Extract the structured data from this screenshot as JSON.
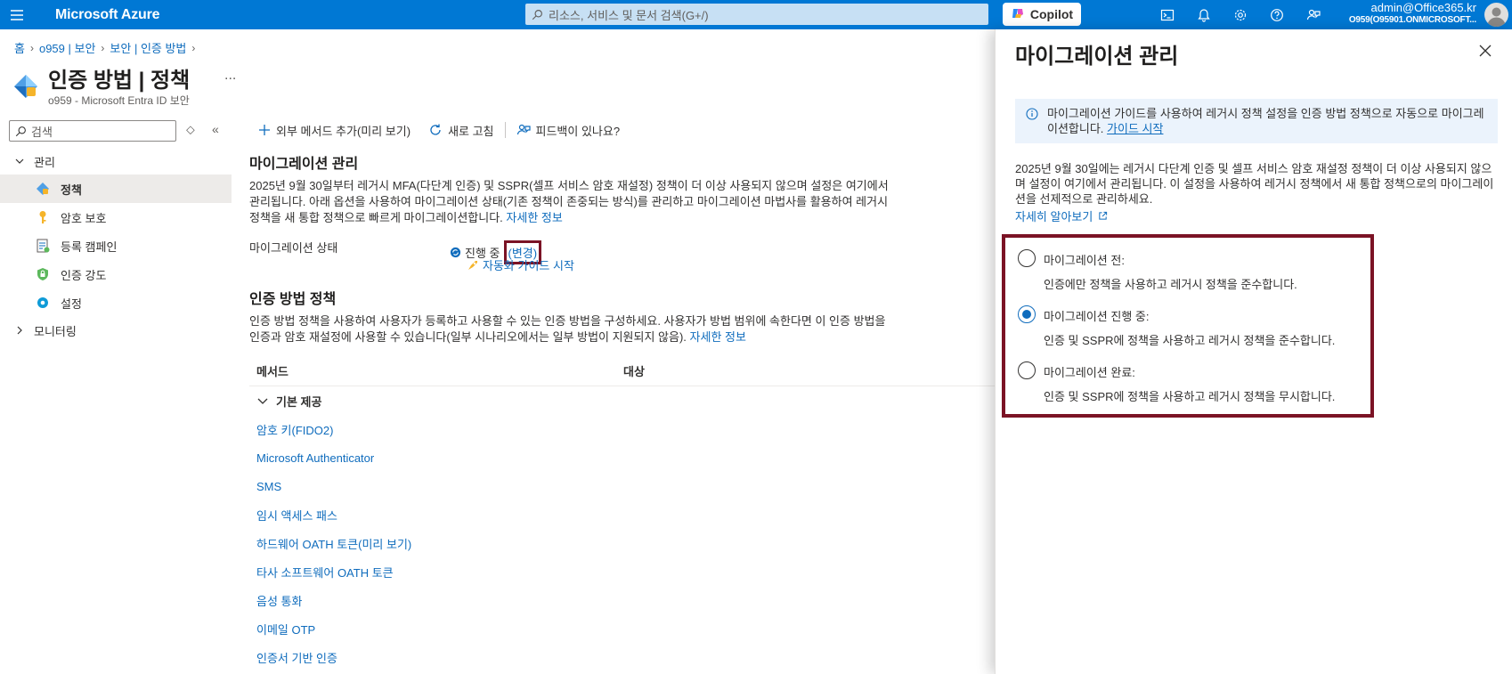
{
  "topbar": {
    "brand": "Microsoft Azure",
    "search_placeholder": "리소스, 서비스 및 문서 검색(G+/)",
    "copilot_label": "Copilot",
    "account_user": "admin@Office365.kr",
    "account_tenant": "O959(O95901.ONMICROSOFT...",
    "icons": [
      "cloud-shell-icon",
      "bell-icon",
      "gear-icon",
      "help-icon",
      "feedback-icon"
    ]
  },
  "breadcrumb": [
    "홈",
    "o959 | 보안",
    "보안 | 인증 방법"
  ],
  "page": {
    "title": "인증 방법 | 정책",
    "subtitle": "o959 - Microsoft Entra ID 보안",
    "more": "..."
  },
  "nav": {
    "search_placeholder": "검색",
    "groups": [
      {
        "label": "관리",
        "expanded": true
      },
      {
        "label": "모니터링",
        "expanded": false
      }
    ],
    "items": [
      {
        "label": "정책",
        "icon": "policy-icon",
        "active": true
      },
      {
        "label": "암호 보호",
        "icon": "key-icon",
        "active": false
      },
      {
        "label": "등록 캠페인",
        "icon": "campaign-icon",
        "active": false
      },
      {
        "label": "인증 강도",
        "icon": "lock-shield-icon",
        "active": false
      },
      {
        "label": "설정",
        "icon": "gear-icon",
        "active": false
      }
    ]
  },
  "toolbar": {
    "add_external": "외부 메서드 추가(미리 보기)",
    "refresh": "새로 고침",
    "feedback": "피드백이 있나요?"
  },
  "migration": {
    "heading": "마이그레이션 관리",
    "description": "2025년 9월 30일부터 레거시 MFA(다단계 인증) 및 SSPR(셀프 서비스 암호 재설정) 정책이 더 이상 사용되지 않으며 설정은 여기에서 관리됩니다. 아래 옵션을 사용하여 마이그레이션 상태(기존 정책이 존중되는 방식)를 관리하고 마이그레이션 마법사를 활용하여 레거시 정책을 새 통합 정책으로 빠르게 마이그레이션합니다.",
    "learn_more": "자세한 정보",
    "status_label": "마이그레이션 상태",
    "status_value": "진행 중",
    "change_link": "(변경)",
    "guide_link": "자동화 가이드 시작"
  },
  "policy": {
    "heading": "인증 방법 정책",
    "description": "인증 방법 정책을 사용하여 사용자가 등록하고 사용할 수 있는 인증 방법을 구성하세요. 사용자가 방법 범위에 속한다면 이 인증 방법을 인증과 암호 재설정에 사용할 수 있습니다(일부 시나리오에서는 일부 방법이 지원되지 않음).",
    "learn_more": "자세한 정보"
  },
  "table": {
    "col_method": "메서드",
    "col_target": "대상",
    "group": "기본 제공",
    "methods": [
      "암호 키(FIDO2)",
      "Microsoft Authenticator",
      "SMS",
      "임시 액세스 패스",
      "하드웨어 OATH 토큰(미리 보기)",
      "타사 소프트웨어 OATH 토큰",
      "음성 통화",
      "이메일 OTP",
      "인증서 기반 인증"
    ]
  },
  "panel": {
    "title": "마이그레이션 관리",
    "info_text": "마이그레이션 가이드를 사용하여 레거시 정책 설정을 인증 방법 정책으로 자동으로 마이그레이션합니다.",
    "info_link": "가이드 시작",
    "description": "2025년 9월 30일에는 레거시 다단계 인증 및 셀프 서비스 암호 재설정 정책이 더 이상 사용되지 않으며 설정이 여기에서 관리됩니다. 이 설정을 사용하여 레거시 정책에서 새 통합 정책으로의 마이그레이션을 선제적으로 관리하세요.",
    "learn_more": "자세히 알아보기",
    "options": [
      {
        "label": "마이그레이션 전:",
        "desc": "인증에만 정책을 사용하고 레거시 정책을 준수합니다.",
        "checked": false
      },
      {
        "label": "마이그레이션 진행 중:",
        "desc": "인증 및 SSPR에 정책을 사용하고 레거시 정책을 준수합니다.",
        "checked": true
      },
      {
        "label": "마이그레이션 완료:",
        "desc": "인증 및 SSPR에 정책을 사용하고 레거시 정책을 무시합니다.",
        "checked": false
      }
    ]
  },
  "colors": {
    "azure_blue": "#0078d4",
    "link": "#0f6cbd",
    "highlight_border": "#7b1325"
  }
}
